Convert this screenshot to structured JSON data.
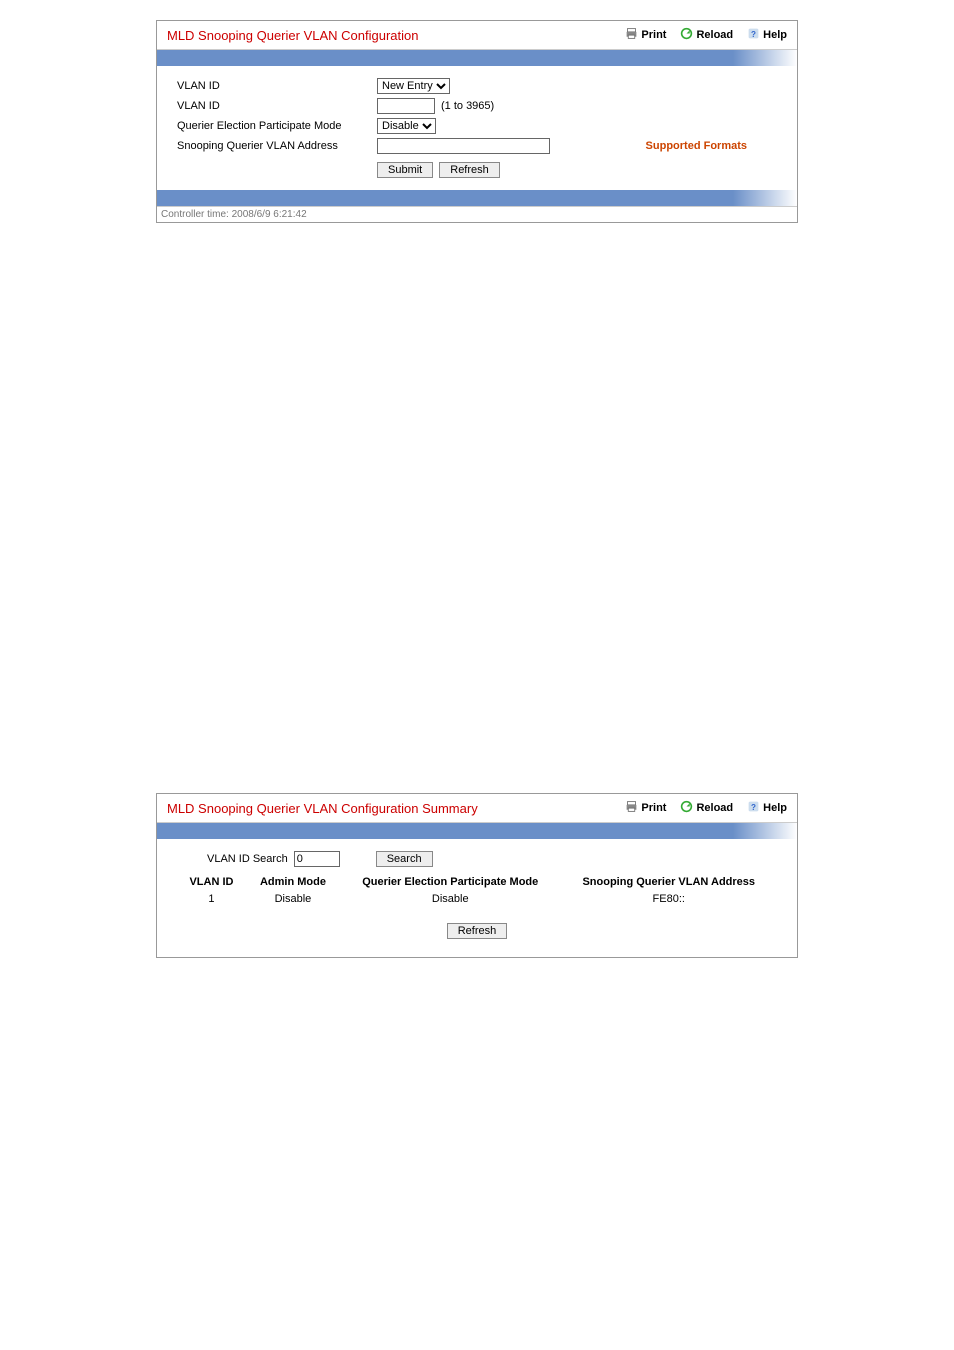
{
  "panel1": {
    "title": "MLD Snooping Querier VLAN Configuration",
    "actions": {
      "print": "Print",
      "reload": "Reload",
      "help": "Help"
    },
    "fields": {
      "vlan_id_sel_label": "VLAN ID",
      "vlan_id_sel_value": "New Entry",
      "vlan_id_input_label": "VLAN ID",
      "vlan_id_input_value": "",
      "vlan_id_range": "(1 to 3965)",
      "querier_mode_label": "Querier Election Participate Mode",
      "querier_mode_value": "Disable",
      "snooping_addr_label": "Snooping Querier VLAN Address",
      "snooping_addr_value": "",
      "supported_formats": "Supported Formats"
    },
    "buttons": {
      "submit": "Submit",
      "refresh": "Refresh"
    },
    "footer": "Controller time: 2008/6/9 6:21:42"
  },
  "panel2": {
    "title": "MLD Snooping Querier VLAN Configuration Summary",
    "actions": {
      "print": "Print",
      "reload": "Reload",
      "help": "Help"
    },
    "search": {
      "label": "VLAN ID Search",
      "value": "0",
      "button": "Search"
    },
    "table": {
      "headers": {
        "vlan_id": "VLAN ID",
        "admin_mode": "Admin Mode",
        "querier_mode": "Querier Election Participate Mode",
        "snooping_addr": "Snooping Querier VLAN Address"
      },
      "rows": [
        {
          "vlan_id": "1",
          "admin_mode": "Disable",
          "querier_mode": "Disable",
          "snooping_addr": "FE80::"
        }
      ]
    },
    "buttons": {
      "refresh": "Refresh"
    }
  }
}
